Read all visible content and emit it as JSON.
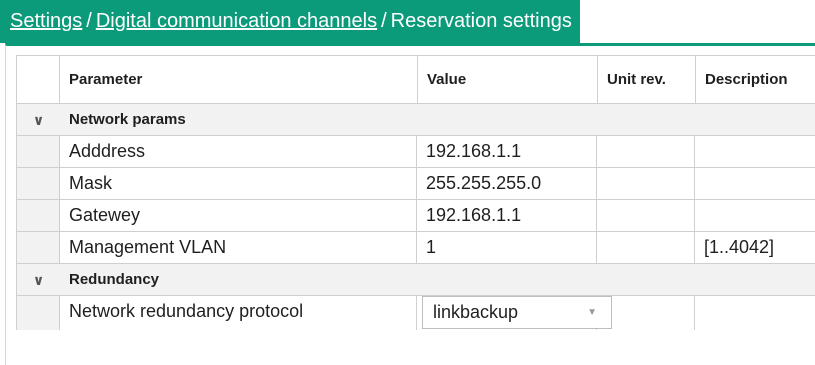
{
  "breadcrumb": {
    "settings": "Settings",
    "separator1": "/",
    "digital_channels": "Digital communication channels",
    "separator2": "/",
    "current": "Reservation settings"
  },
  "columns": {
    "parameter": "Parameter",
    "value": "Value",
    "unit": "Unit rev.",
    "description": "Description"
  },
  "groups": {
    "network": {
      "title": "Network params",
      "toggle_icon": "chevron-down-icon",
      "rows": [
        {
          "parameter": "Adddress",
          "value": "192.168.1.1",
          "unit": "",
          "description": ""
        },
        {
          "parameter": "Mask",
          "value": "255.255.255.0",
          "unit": "",
          "description": ""
        },
        {
          "parameter": "Gatewey",
          "value": "192.168.1.1",
          "unit": "",
          "description": ""
        },
        {
          "parameter": "Management VLAN",
          "value": "1",
          "unit": "",
          "description": "[1..4042]"
        }
      ]
    },
    "redundancy": {
      "title": "Redundancy",
      "toggle_icon": "chevron-down-icon",
      "rows": [
        {
          "parameter": "Network redundancy protocol",
          "value": "linkbackup",
          "unit": "",
          "description": ""
        }
      ]
    }
  },
  "colors": {
    "accent": "#0b9a7a",
    "group_bg": "#f2f2f2",
    "grid_line": "#cfcfcf"
  }
}
